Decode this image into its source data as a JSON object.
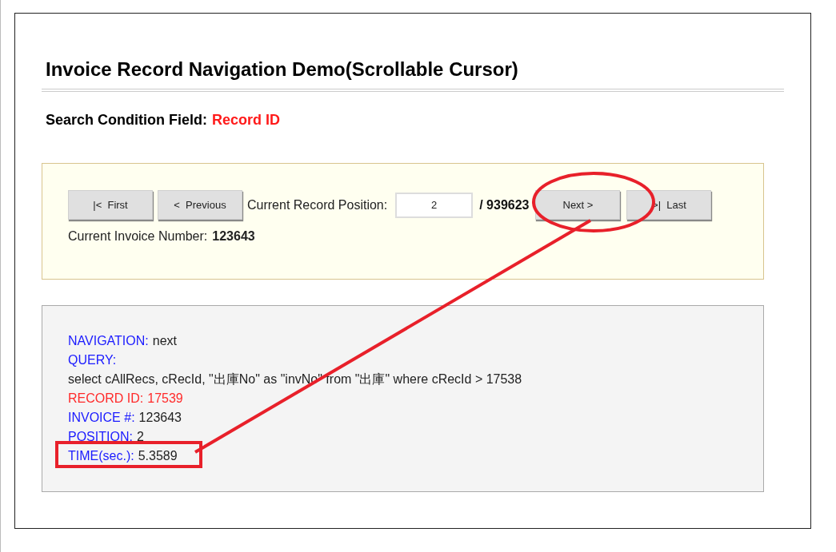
{
  "title": "Invoice Record Navigation Demo(Scrollable Cursor)",
  "search_condition": {
    "label": "Search Condition Field:",
    "value": "Record ID"
  },
  "navigation": {
    "buttons": [
      {
        "label": "|<  First"
      },
      {
        "label": "<  Previous"
      }
    ],
    "position_label": "Current Record Position:",
    "position_value": "2",
    "total": "/ 939623",
    "buttons_after": [
      {
        "label": "Next >"
      },
      {
        "label": ">|  Last"
      }
    ],
    "invoice_label": "Current Invoice Number:",
    "invoice_value": "123643"
  },
  "log": [
    {
      "kind": "field",
      "label": "NAVIGATION:",
      "value": "next",
      "color": "#1a1aff"
    },
    {
      "kind": "field",
      "label": "QUERY:",
      "color": "#1a1aff"
    },
    {
      "kind": "text",
      "value": "select cAllRecs, cRecId, \"出庫No\" as \"invNo\" from \"出庫\" where cRecId > 17538"
    },
    {
      "kind": "field",
      "label": "RECORD ID:",
      "value": "17539",
      "color": "#ff2a2a"
    },
    {
      "kind": "field",
      "label": "INVOICE #:",
      "value": "123643",
      "color": "#1a1aff"
    },
    {
      "kind": "field",
      "label": "POSITION:",
      "value": "2",
      "color": "#1a1aff"
    },
    {
      "kind": "field",
      "label": "TIME(sec.):",
      "value": "5.3589",
      "color": "#1a1aff"
    }
  ]
}
